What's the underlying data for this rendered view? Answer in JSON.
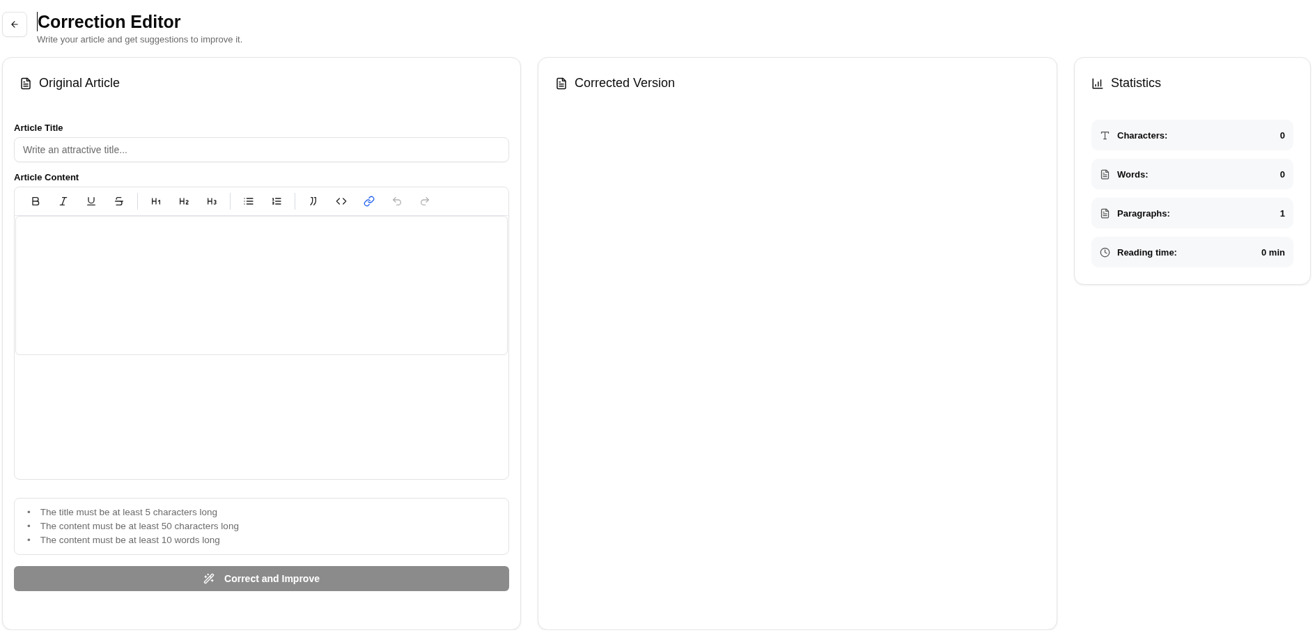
{
  "header": {
    "title": "Correction Editor",
    "subtitle": "Write your article and get suggestions to improve it."
  },
  "original_article": {
    "heading": "Original Article",
    "title_field": {
      "label": "Article Title",
      "placeholder": "Write an attractive title..."
    },
    "content_label": "Article Content",
    "toolbar": [
      {
        "kind": "bold",
        "active": false,
        "disabled": false
      },
      {
        "kind": "italic",
        "active": false,
        "disabled": false
      },
      {
        "kind": "underline",
        "active": false,
        "disabled": false
      },
      {
        "kind": "strikethrough",
        "active": false,
        "disabled": false
      },
      {
        "kind": "separator"
      },
      {
        "kind": "heading1",
        "active": false,
        "disabled": false
      },
      {
        "kind": "heading2",
        "active": false,
        "disabled": false
      },
      {
        "kind": "heading3",
        "active": false,
        "disabled": false
      },
      {
        "kind": "separator"
      },
      {
        "kind": "bullet-list",
        "active": false,
        "disabled": false
      },
      {
        "kind": "numbered-list",
        "active": false,
        "disabled": false
      },
      {
        "kind": "separator"
      },
      {
        "kind": "quote",
        "active": false,
        "disabled": false
      },
      {
        "kind": "code",
        "active": false,
        "disabled": false
      },
      {
        "kind": "link",
        "active": true,
        "disabled": false
      },
      {
        "kind": "undo",
        "active": false,
        "disabled": true
      },
      {
        "kind": "redo",
        "active": false,
        "disabled": true
      }
    ],
    "requirements": [
      {
        "marker": "•",
        "text": "The title must be at least 5 characters long"
      },
      {
        "marker": "•",
        "text": "The content must be at least 50 characters long"
      },
      {
        "marker": "•",
        "text": "The content must be at least 10 words long"
      }
    ],
    "submit": {
      "label": "Correct and Improve",
      "disabled": true
    }
  },
  "corrected_version": {
    "heading": "Corrected Version"
  },
  "statistics": {
    "heading": "Statistics",
    "items": [
      {
        "kind": "characters",
        "label": "Characters:",
        "value": "0"
      },
      {
        "kind": "words",
        "label": "Words:",
        "value": "0"
      },
      {
        "kind": "paragraphs",
        "label": "Paragraphs:",
        "value": "1"
      },
      {
        "kind": "reading-time",
        "label": "Reading time:",
        "value": "0 min"
      }
    ]
  }
}
